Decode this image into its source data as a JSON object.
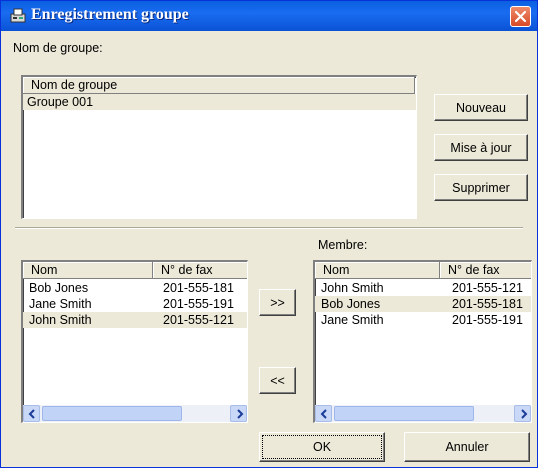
{
  "window": {
    "title": "Enregistrement groupe",
    "icon": "fax-machine-icon"
  },
  "group": {
    "label": "Nom de groupe:",
    "column_header": "Nom de groupe",
    "rows": [
      "Groupe 001"
    ]
  },
  "buttons": {
    "new": "Nouveau",
    "update": "Mise à jour",
    "delete": "Supprimer",
    "add": ">>",
    "remove": "<<",
    "ok": "OK",
    "cancel": "Annuler"
  },
  "contacts": {
    "headers": [
      "Nom",
      "N° de fax"
    ],
    "rows": [
      [
        "Bob Jones",
        "201-555-181"
      ],
      [
        "Jane Smith",
        "201-555-191"
      ],
      [
        "John Smith",
        "201-555-121"
      ]
    ]
  },
  "members": {
    "label": "Membre:",
    "headers": [
      "Nom",
      "N° de fax"
    ],
    "rows": [
      [
        "John Smith",
        "201-555-121"
      ],
      [
        "Bob Jones",
        "201-555-181"
      ],
      [
        "Jane Smith",
        "201-555-191"
      ]
    ]
  },
  "colors": {
    "title_bar": "#0a5fe0",
    "close": "#d84a26",
    "dialog": "#ece9d8"
  }
}
